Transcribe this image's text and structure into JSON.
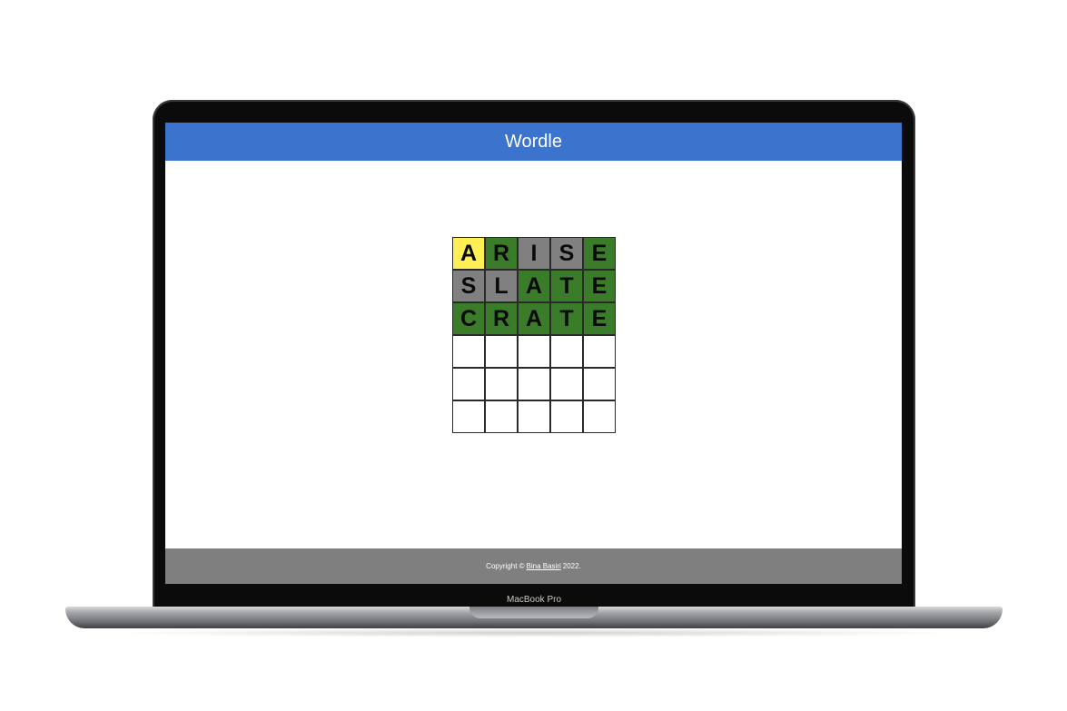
{
  "device": {
    "label": "MacBook Pro"
  },
  "header": {
    "title": "Wordle"
  },
  "colors": {
    "correct": "#3a7c2a",
    "present": "#ffef55",
    "absent": "#808080",
    "empty": "#ffffff",
    "header": "#3c74cd",
    "footer": "#7f7f7f"
  },
  "board": {
    "rows": [
      {
        "letters": [
          "A",
          "R",
          "I",
          "S",
          "E"
        ],
        "states": [
          "present",
          "correct",
          "absent",
          "absent",
          "correct"
        ]
      },
      {
        "letters": [
          "S",
          "L",
          "A",
          "T",
          "E"
        ],
        "states": [
          "absent",
          "absent",
          "correct",
          "correct",
          "correct"
        ]
      },
      {
        "letters": [
          "C",
          "R",
          "A",
          "T",
          "E"
        ],
        "states": [
          "correct",
          "correct",
          "correct",
          "correct",
          "correct"
        ]
      },
      {
        "letters": [
          "",
          "",
          "",
          "",
          ""
        ],
        "states": [
          "empty",
          "empty",
          "empty",
          "empty",
          "empty"
        ]
      },
      {
        "letters": [
          "",
          "",
          "",
          "",
          ""
        ],
        "states": [
          "empty",
          "empty",
          "empty",
          "empty",
          "empty"
        ]
      },
      {
        "letters": [
          "",
          "",
          "",
          "",
          ""
        ],
        "states": [
          "empty",
          "empty",
          "empty",
          "empty",
          "empty"
        ]
      }
    ]
  },
  "footer": {
    "prefix": "Copyright ©",
    "author": "Bina Basiri",
    "suffix": "2022."
  }
}
